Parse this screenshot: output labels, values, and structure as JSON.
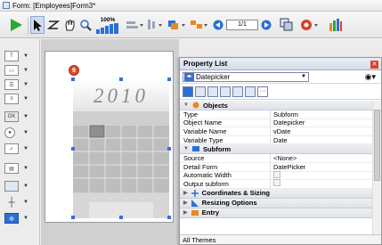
{
  "window": {
    "title": "Form: [Employees]Form3*"
  },
  "toolbar": {
    "zoom_label": "100%",
    "page_indicator": "1/1",
    "colors": {
      "run": "#2aa832",
      "accent_blue": "#2b6fd6",
      "accent_orange": "#e7891c",
      "accent_red": "#d8432c"
    }
  },
  "canvas": {
    "year_text": "2010",
    "badge_text": "9"
  },
  "property_list": {
    "title": "Property List",
    "object_selector": "Datepicker",
    "sections": [
      {
        "title": "Objects",
        "rows": [
          {
            "key": "Type",
            "value": "Subform"
          },
          {
            "key": "Object Name",
            "value": "Datepicker"
          },
          {
            "key": "Variable Name",
            "value": "vDate"
          },
          {
            "key": "Variable Type",
            "value": "Date"
          }
        ]
      },
      {
        "title": "Subform",
        "rows": [
          {
            "key": "Source",
            "value": "<None>"
          },
          {
            "key": "Detail Form",
            "value": "DatePicker"
          },
          {
            "key": "Automatic Width",
            "value": ""
          },
          {
            "key": "Output subform",
            "value": ""
          }
        ]
      }
    ],
    "collapsed_groups": [
      "Coordinates & Sizing",
      "Resizing Options",
      "Entry"
    ],
    "footer": "All Themes"
  }
}
